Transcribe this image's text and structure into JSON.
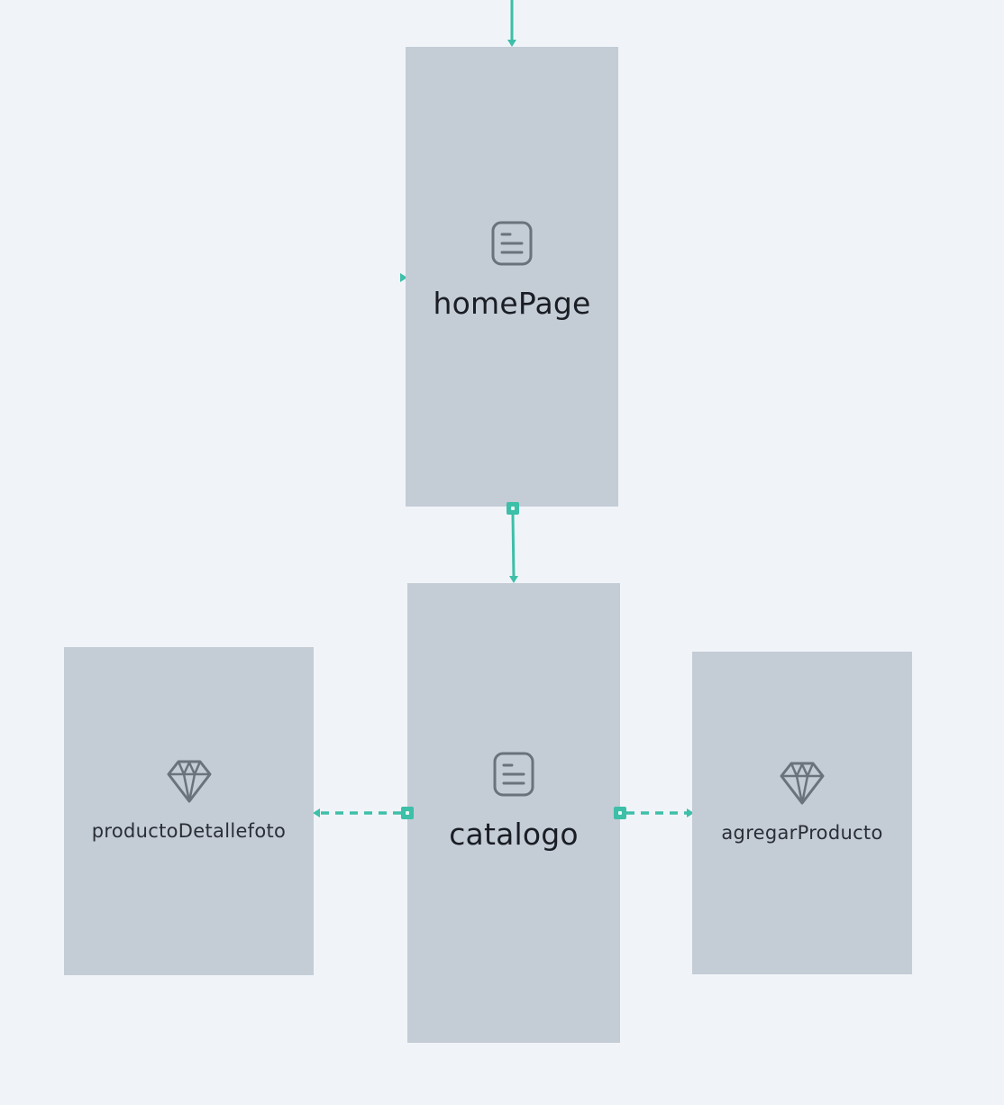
{
  "diagram": {
    "nodes": [
      {
        "id": "homePage",
        "label": "homePage",
        "icon": "page-icon"
      },
      {
        "id": "catalogo",
        "label": "catalogo",
        "icon": "page-icon"
      },
      {
        "id": "productoDetallefoto",
        "label": "productoDetallefoto",
        "icon": "gem-icon"
      },
      {
        "id": "agregarProducto",
        "label": "agregarProducto",
        "icon": "gem-icon"
      }
    ],
    "edges": [
      {
        "from": "incoming",
        "to": "homePage",
        "style": "solid"
      },
      {
        "from": "homePage",
        "to": "catalogo",
        "style": "solid"
      },
      {
        "from": "catalogo",
        "to": "productoDetallefoto",
        "style": "dashed"
      },
      {
        "from": "catalogo",
        "to": "agregarProducto",
        "style": "dashed"
      }
    ]
  },
  "colors": {
    "canvas": "#f0f4f8",
    "node": "#c4ccd6",
    "edge": "#3dbfa8",
    "text": "#1a1e24",
    "icon": "#6a727c"
  }
}
